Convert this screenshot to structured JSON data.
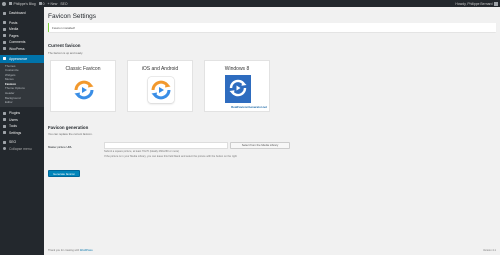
{
  "admin_bar": {
    "site_name": "Philippe's Blog",
    "comments_count": "0",
    "new_label": "New",
    "extra_item": "SEO",
    "account_label": "Howdy, Philippe Bernard"
  },
  "sidebar": {
    "items": [
      {
        "label": "Dashboard",
        "icon": "dashboard-icon"
      },
      {
        "label": "Posts",
        "icon": "pin-icon"
      },
      {
        "label": "Media",
        "icon": "media-icon"
      },
      {
        "label": "Pages",
        "icon": "page-icon"
      },
      {
        "label": "Comments",
        "icon": "comment-icon"
      },
      {
        "label": "WooPress",
        "icon": "plugin-icon"
      },
      {
        "label": "Appearance",
        "icon": "brush-icon"
      }
    ],
    "submenu": [
      {
        "label": "Themes"
      },
      {
        "label": "Customize"
      },
      {
        "label": "Widgets"
      },
      {
        "label": "Menus"
      },
      {
        "label": "Favicon"
      },
      {
        "label": "Theme Options"
      },
      {
        "label": "Header"
      },
      {
        "label": "Background"
      },
      {
        "label": "Editor"
      }
    ],
    "items_after": [
      {
        "label": "Plugins",
        "icon": "plugin-icon"
      },
      {
        "label": "Users",
        "icon": "user-icon"
      },
      {
        "label": "Tools",
        "icon": "wrench-icon"
      },
      {
        "label": "Settings",
        "icon": "settings-icon"
      },
      {
        "label": "SEO",
        "icon": "seo-icon"
      },
      {
        "label": "Collapse menu",
        "icon": "collapse-icon"
      }
    ]
  },
  "page": {
    "title": "Favicon Settings",
    "notice": "Favicon installed!",
    "current_heading": "Current favicon",
    "current_desc": "The favicon is up and ready.",
    "previews": [
      {
        "title": "Classic Favicon"
      },
      {
        "title": "iOS and Android"
      },
      {
        "title": "Windows 8",
        "credit": "RealFaviconGenerator.net"
      }
    ],
    "generation_heading": "Favicon generation",
    "generation_desc": "You can replace the current favicon.",
    "master_label": "Master picture URL",
    "master_value": "",
    "library_button": "Select from the Media Library",
    "hint1": "Submit a square picture, at least 70x70 (ideally 260x260 or more)",
    "hint2": "If the picture is in your Media Library, you can leave this field blank and select the picture with the button on the right",
    "generate_button": "Generate favicon"
  },
  "footer": {
    "left_text": "Thank you for creating with ",
    "left_link": "WordPress",
    "version": "Version 4.1"
  },
  "colors": {
    "admin_bar": "#23282d",
    "sidebar": "#23282d",
    "accent": "#0073aa",
    "notice_border": "#7ad03a",
    "logo_orange": "#f2992e",
    "logo_blue": "#3a8ee6",
    "windows_tile": "#2e6cbf"
  }
}
